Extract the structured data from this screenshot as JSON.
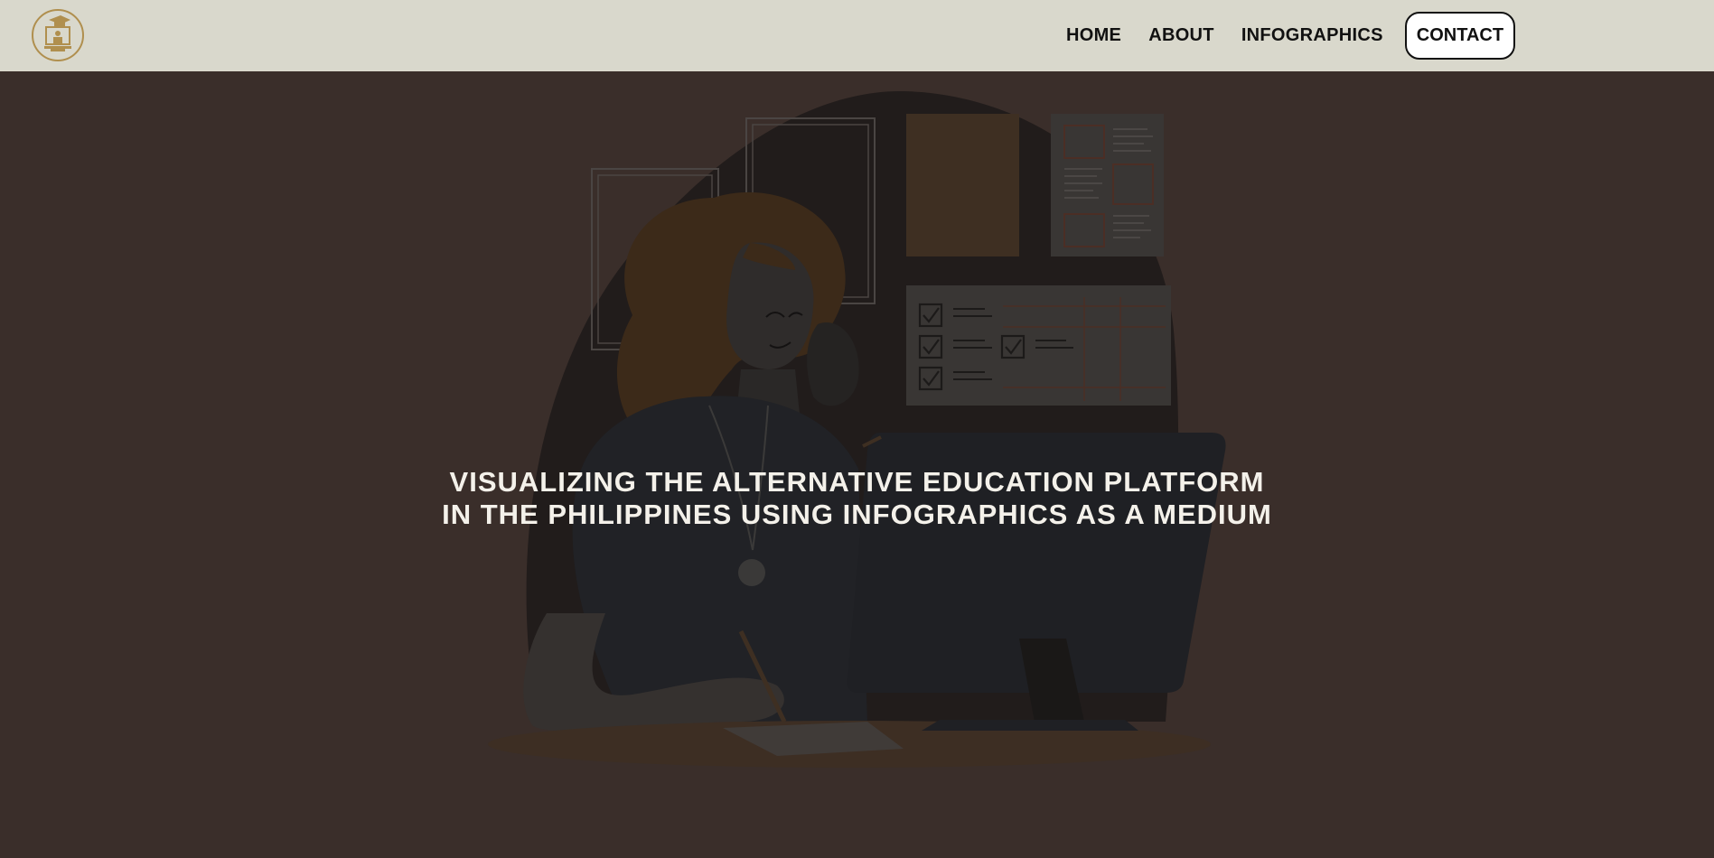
{
  "nav": {
    "logo_icon": "graduation-cap-computer-icon",
    "links": [
      {
        "label": "HOME"
      },
      {
        "label": "ABOUT"
      },
      {
        "label": "INFOGRAPHICS"
      }
    ],
    "contact_label": "CONTACT"
  },
  "hero": {
    "title_line1": "VISUALIZING THE ALTERNATIVE EDUCATION PLATFORM",
    "title_line2": "IN THE PHILIPPINES USING INFOGRAPHICS AS A MEDIUM",
    "illustration": "woman-on-phone-at-computer-illustration"
  },
  "colors": {
    "nav_bg": "#d9d8cc",
    "hero_bg": "#3a2e2a",
    "logo_accent": "#b08f4e",
    "title_text": "#f4f1ea"
  }
}
